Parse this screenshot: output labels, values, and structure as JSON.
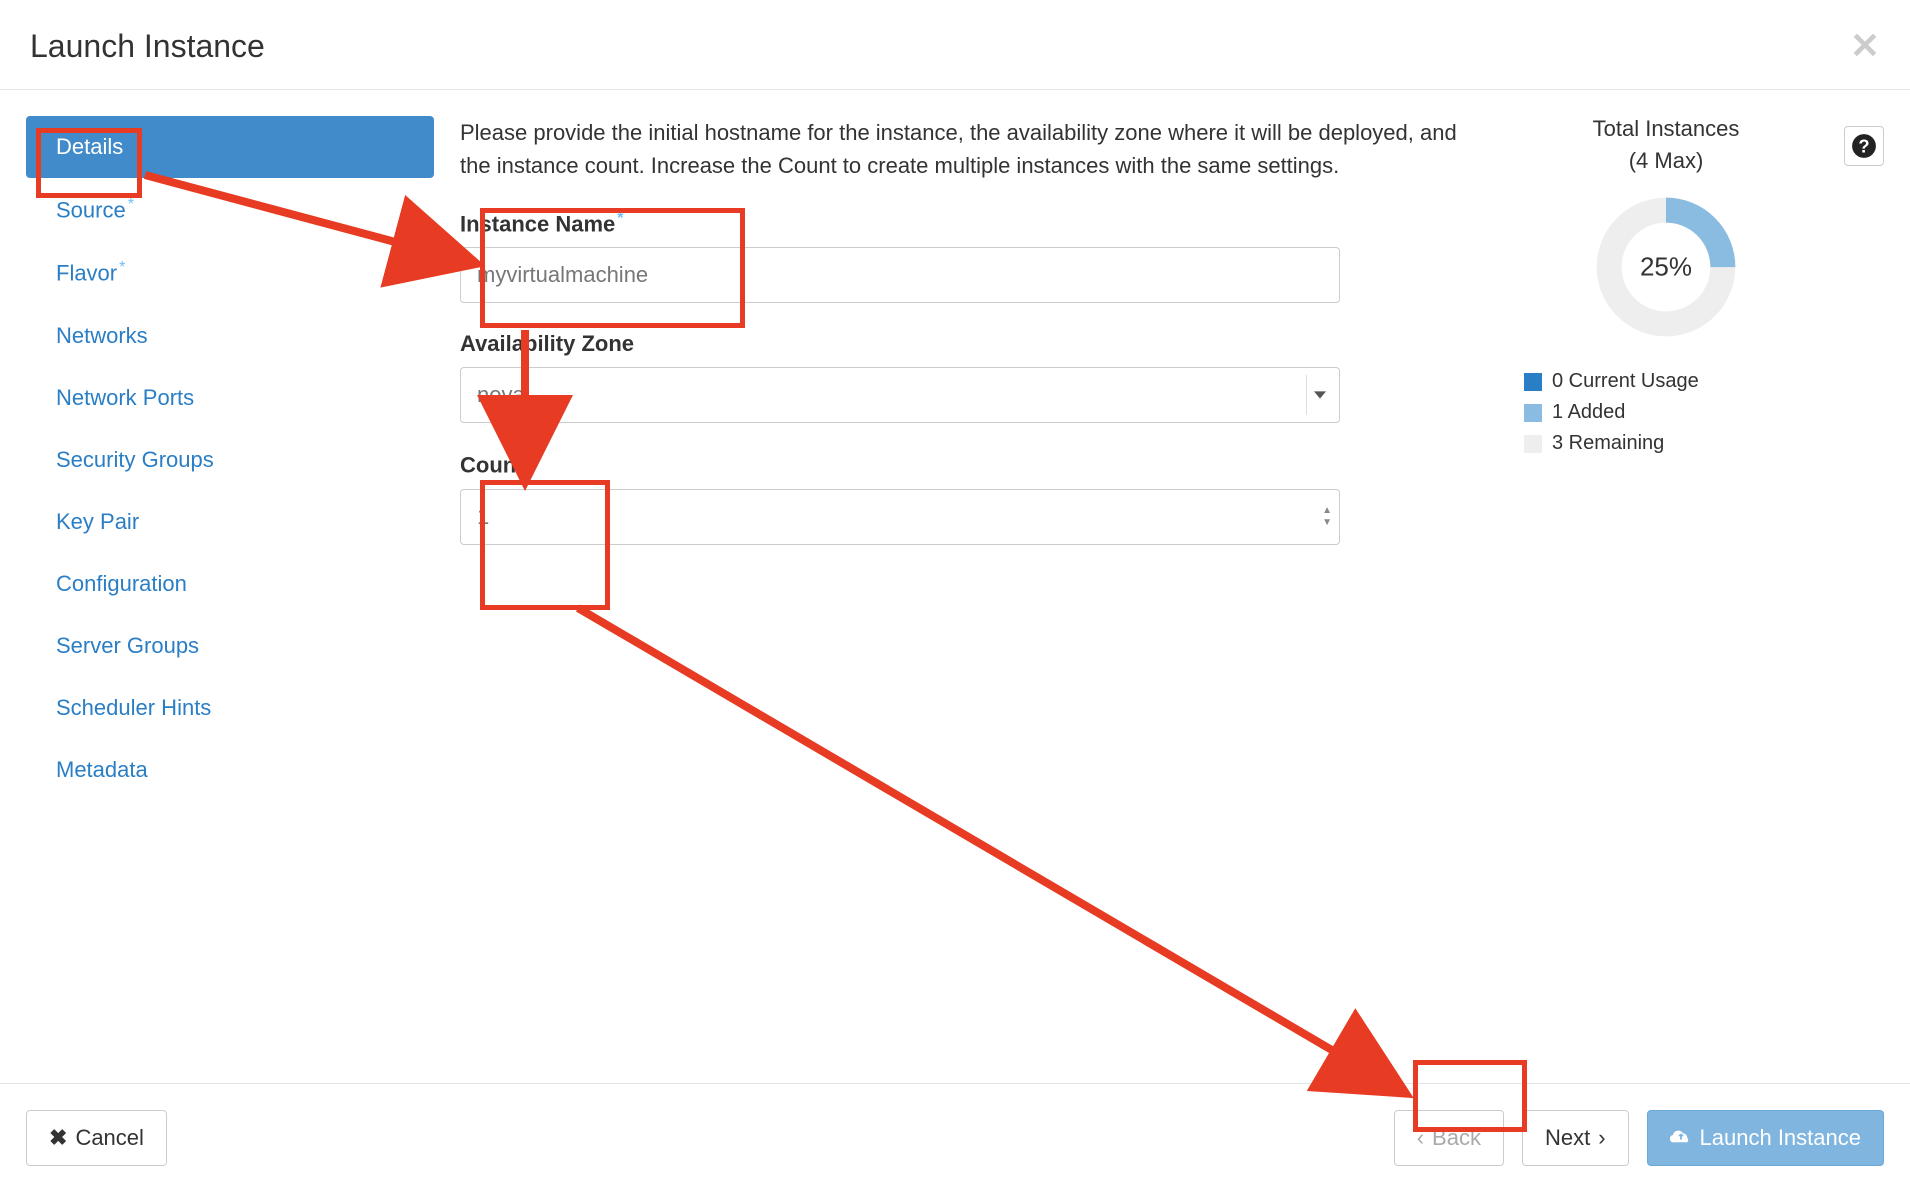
{
  "header": {
    "title": "Launch Instance"
  },
  "sidebar": {
    "items": [
      {
        "label": "Details",
        "active": true,
        "required": false
      },
      {
        "label": "Source",
        "active": false,
        "required": true
      },
      {
        "label": "Flavor",
        "active": false,
        "required": true
      },
      {
        "label": "Networks",
        "active": false,
        "required": false
      },
      {
        "label": "Network Ports",
        "active": false,
        "required": false
      },
      {
        "label": "Security Groups",
        "active": false,
        "required": false
      },
      {
        "label": "Key Pair",
        "active": false,
        "required": false
      },
      {
        "label": "Configuration",
        "active": false,
        "required": false
      },
      {
        "label": "Server Groups",
        "active": false,
        "required": false
      },
      {
        "label": "Scheduler Hints",
        "active": false,
        "required": false
      },
      {
        "label": "Metadata",
        "active": false,
        "required": false
      }
    ]
  },
  "main": {
    "description": "Please provide the initial hostname for the instance, the availability zone where it will be deployed, and the instance count. Increase the Count to create multiple instances with the same settings.",
    "fields": {
      "instance_name": {
        "label": "Instance Name",
        "value": "myvirtualmachine",
        "required": true
      },
      "availability_zone": {
        "label": "Availability Zone",
        "value": "nova",
        "required": false
      },
      "count": {
        "label": "Count",
        "value": "1",
        "required": true
      }
    }
  },
  "side": {
    "title": "Total Instances",
    "subtitle": "(4 Max)",
    "percent": "25%",
    "legend": [
      {
        "color": "#2a7ec5",
        "label": "0 Current Usage"
      },
      {
        "color": "#8abce2",
        "label": "1 Added"
      },
      {
        "color": "#eeeeee",
        "label": "3 Remaining"
      }
    ]
  },
  "chart_data": {
    "type": "pie",
    "title": "Total Instances (4 Max)",
    "categories": [
      "Current Usage",
      "Added",
      "Remaining"
    ],
    "values": [
      0,
      1,
      3
    ],
    "percent_used": 25,
    "colors": [
      "#2a7ec5",
      "#8abce2",
      "#eeeeee"
    ]
  },
  "footer": {
    "cancel": "Cancel",
    "back": "Back",
    "next": "Next",
    "launch": "Launch Instance"
  }
}
